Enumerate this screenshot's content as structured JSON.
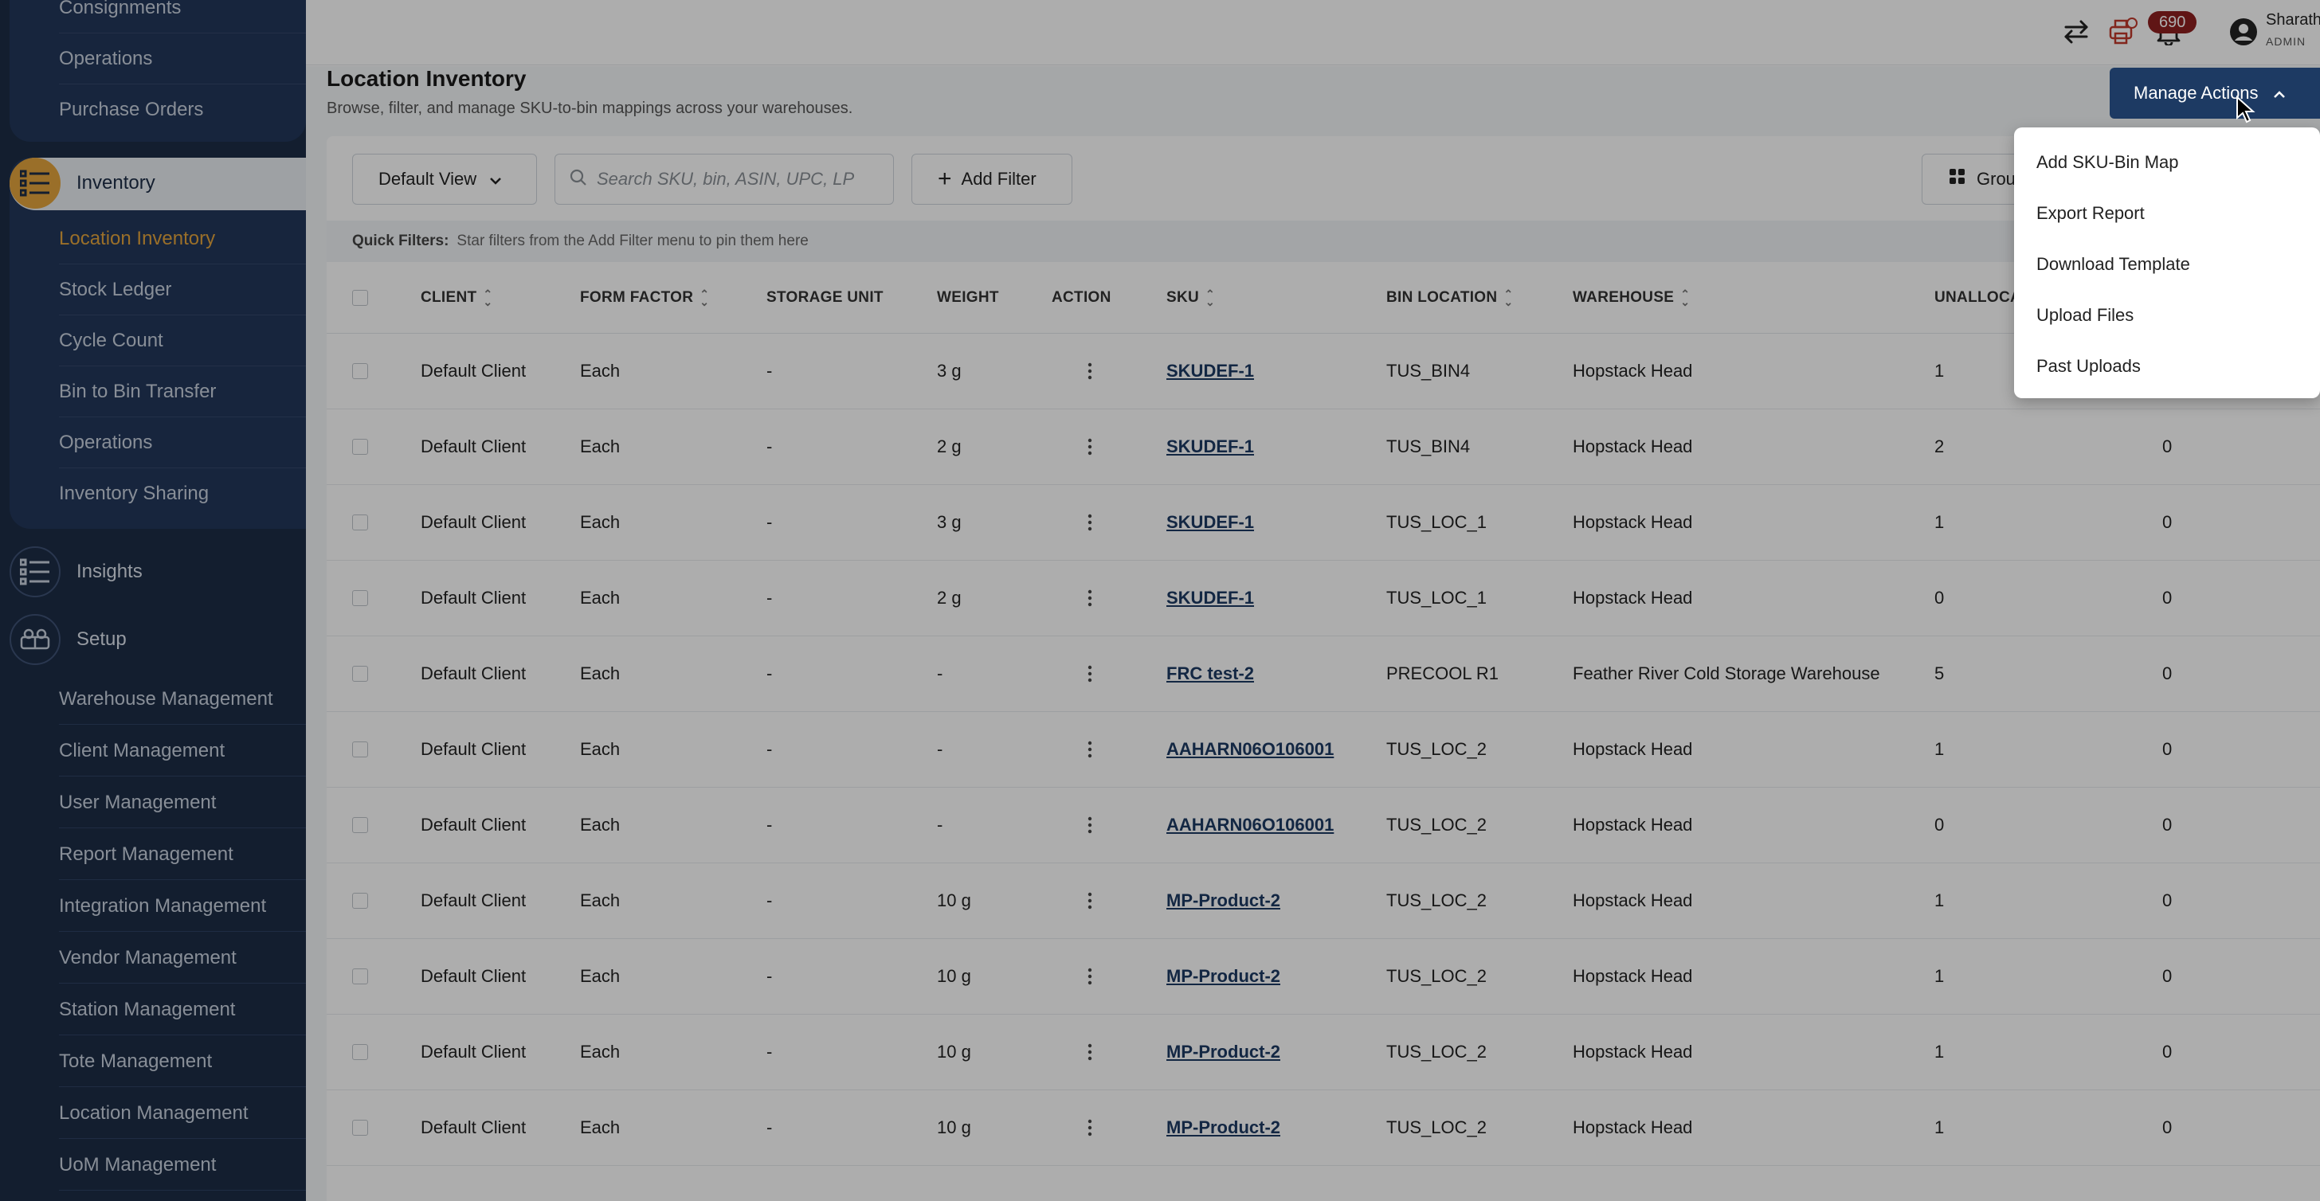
{
  "sidebar": {
    "top_items": [
      "Consignments",
      "Operations",
      "Purchase Orders"
    ],
    "inventory": {
      "label": "Inventory",
      "items": [
        "Location Inventory",
        "Stock Ledger",
        "Cycle Count",
        "Bin to Bin Transfer",
        "Operations",
        "Inventory Sharing"
      ],
      "active": "Location Inventory"
    },
    "insights": {
      "label": "Insights"
    },
    "setup": {
      "label": "Setup",
      "items": [
        "Warehouse Management",
        "Client Management",
        "User Management",
        "Report Management",
        "Integration Management",
        "Vendor Management",
        "Station Management",
        "Tote Management",
        "Location Management",
        "UoM Management"
      ]
    }
  },
  "topbar": {
    "notification_count": "690",
    "user_name": "Sharath",
    "user_role": "ADMIN"
  },
  "page": {
    "title": "Location Inventory",
    "subtitle": "Browse, filter, and manage SKU-to-bin mappings across your warehouses.",
    "manage_actions_label": "Manage Actions"
  },
  "toolbar": {
    "view_label": "Default View",
    "search_placeholder": "Search SKU, bin, ASIN, UPC, LP",
    "add_filter_label": "Add Filter",
    "group_label": "Grou"
  },
  "quick_filters": {
    "label": "Quick Filters:",
    "hint": "Star filters from the Add Filter menu to pin them here"
  },
  "table": {
    "columns": [
      "CLIENT",
      "FORM FACTOR",
      "STORAGE UNIT",
      "WEIGHT",
      "ACTION",
      "SKU",
      "BIN LOCATION",
      "WAREHOUSE",
      "UNALLOCA"
    ],
    "rows": [
      [
        "Default Client",
        "Each",
        "-",
        "3 g",
        "SKUDEF-1",
        "TUS_BIN4",
        "Hopstack Head",
        "1",
        ""
      ],
      [
        "Default Client",
        "Each",
        "-",
        "2 g",
        "SKUDEF-1",
        "TUS_BIN4",
        "Hopstack Head",
        "2",
        "0"
      ],
      [
        "Default Client",
        "Each",
        "-",
        "3 g",
        "SKUDEF-1",
        "TUS_LOC_1",
        "Hopstack Head",
        "1",
        "0"
      ],
      [
        "Default Client",
        "Each",
        "-",
        "2 g",
        "SKUDEF-1",
        "TUS_LOC_1",
        "Hopstack Head",
        "0",
        "0"
      ],
      [
        "Default Client",
        "Each",
        "-",
        "-",
        "FRC test-2",
        "PRECOOL R1",
        "Feather River Cold Storage Warehouse",
        "5",
        "0"
      ],
      [
        "Default Client",
        "Each",
        "-",
        "-",
        "AAHARN06O106001",
        "TUS_LOC_2",
        "Hopstack Head",
        "1",
        "0"
      ],
      [
        "Default Client",
        "Each",
        "-",
        "-",
        "AAHARN06O106001",
        "TUS_LOC_2",
        "Hopstack Head",
        "0",
        "0"
      ],
      [
        "Default Client",
        "Each",
        "-",
        "10 g",
        "MP-Product-2",
        "TUS_LOC_2",
        "Hopstack Head",
        "1",
        "0"
      ],
      [
        "Default Client",
        "Each",
        "-",
        "10 g",
        "MP-Product-2",
        "TUS_LOC_2",
        "Hopstack Head",
        "1",
        "0"
      ],
      [
        "Default Client",
        "Each",
        "-",
        "10 g",
        "MP-Product-2",
        "TUS_LOC_2",
        "Hopstack Head",
        "1",
        "0"
      ],
      [
        "Default Client",
        "Each",
        "-",
        "10 g",
        "MP-Product-2",
        "TUS_LOC_2",
        "Hopstack Head",
        "1",
        "0"
      ]
    ]
  },
  "dropdown": {
    "items": [
      "Add SKU-Bin Map",
      "Export Report",
      "Download Template",
      "Upload Files",
      "Past Uploads"
    ]
  },
  "colors": {
    "sidebar_bg": "#1c2d46",
    "accent": "#e3a43d",
    "primary": "#1d3a63",
    "badge": "#8e1f1f"
  }
}
